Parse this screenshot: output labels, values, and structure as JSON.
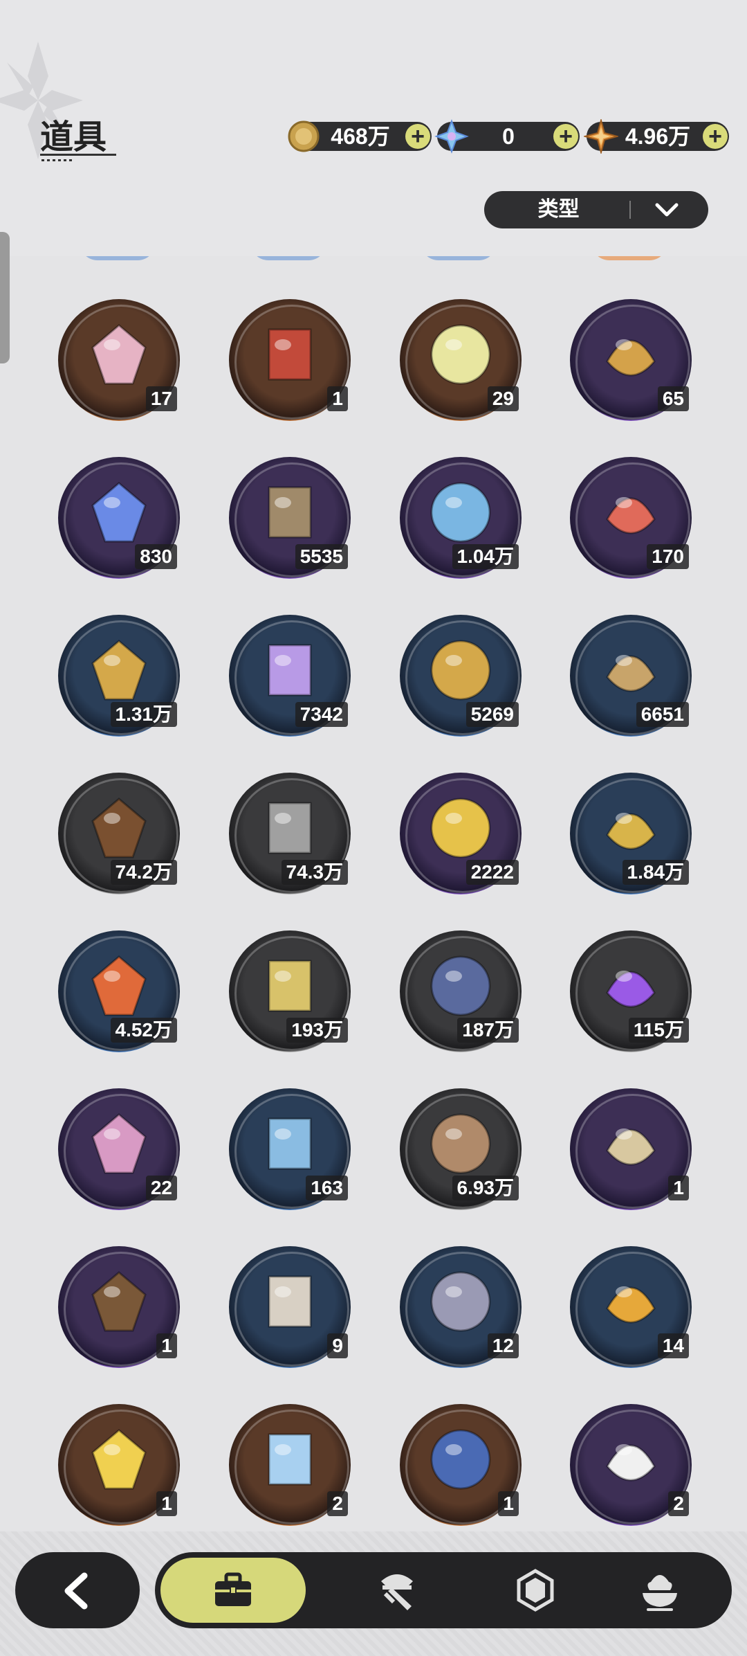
{
  "header": {
    "title": "道具",
    "currencies": [
      {
        "name": "coin-icon",
        "value": "468万"
      },
      {
        "name": "crystal-icon",
        "value": "0"
      },
      {
        "name": "star-gem-icon",
        "value": "4.96万"
      }
    ],
    "plus_label": "+",
    "filter": {
      "label": "类型"
    }
  },
  "colors": {
    "orange": "#e88a42",
    "purple": "#9a62e6",
    "blue": "#5a9aeb",
    "grey": "#c4c4c4",
    "accent": "#d6d87a",
    "dark": "#232325"
  },
  "items": [
    {
      "icon": "peach-fruit-icon",
      "rarity": "orange",
      "count": "17"
    },
    {
      "icon": "wheel-ticket-icon",
      "rarity": "orange",
      "count": "1"
    },
    {
      "icon": "rainbow-ticket-icon",
      "rarity": "orange",
      "count": "29"
    },
    {
      "icon": "meal-ticket-icon",
      "rarity": "purple",
      "count": "65"
    },
    {
      "icon": "moon-coin-icon",
      "rarity": "purple",
      "count": "830"
    },
    {
      "icon": "fist-coin-icon",
      "rarity": "purple",
      "count": "5535"
    },
    {
      "icon": "shield-coin-icon",
      "rarity": "purple",
      "count": "1.04万"
    },
    {
      "icon": "heart-coin-icon",
      "rarity": "purple",
      "count": "170"
    },
    {
      "icon": "golden-blade-icon",
      "rarity": "blue",
      "count": "1.31万"
    },
    {
      "icon": "scale-gem-icon",
      "rarity": "blue",
      "count": "7342"
    },
    {
      "icon": "gear-icon",
      "rarity": "blue",
      "count": "5269"
    },
    {
      "icon": "leaf-icon",
      "rarity": "blue",
      "count": "6651"
    },
    {
      "icon": "wood-logs-icon",
      "rarity": "grey",
      "count": "74.2万"
    },
    {
      "icon": "stone-bricks-icon",
      "rarity": "grey",
      "count": "74.3万"
    },
    {
      "icon": "gold-crystal-icon",
      "rarity": "purple",
      "count": "2222"
    },
    {
      "icon": "gold-dust-icon",
      "rarity": "blue",
      "count": "1.84万"
    },
    {
      "icon": "red-crystal-icon",
      "rarity": "blue",
      "count": "4.52万"
    },
    {
      "icon": "sand-pile-icon",
      "rarity": "grey",
      "count": "193万"
    },
    {
      "icon": "dark-crystal-icon",
      "rarity": "grey",
      "count": "187万"
    },
    {
      "icon": "purple-orb-icon",
      "rarity": "grey",
      "count": "115万"
    },
    {
      "icon": "pink-feed-bag-icon",
      "rarity": "purple",
      "count": "22"
    },
    {
      "icon": "blue-feed-bag-icon",
      "rarity": "blue",
      "count": "163"
    },
    {
      "icon": "brown-feed-bag-icon",
      "rarity": "grey",
      "count": "6.93万"
    },
    {
      "icon": "golden-egg-icon",
      "rarity": "purple",
      "count": "1"
    },
    {
      "icon": "brown-bundle-icon",
      "rarity": "purple",
      "count": "1"
    },
    {
      "icon": "plain-egg-icon",
      "rarity": "blue",
      "count": "9"
    },
    {
      "icon": "grey-bundle-icon",
      "rarity": "blue",
      "count": "12"
    },
    {
      "icon": "potion-vial-icon",
      "rarity": "blue",
      "count": "14"
    },
    {
      "icon": "golden-crown-icon",
      "rarity": "orange",
      "count": "1"
    },
    {
      "icon": "diamond-gift-icon",
      "rarity": "orange",
      "count": "2"
    },
    {
      "icon": "blue-book-icon",
      "rarity": "orange",
      "count": "1"
    },
    {
      "icon": "pillow-icon",
      "rarity": "purple",
      "count": "2"
    }
  ],
  "nav": {
    "back": "back-arrow-icon",
    "tabs": [
      {
        "icon": "briefcase-icon",
        "active": true
      },
      {
        "icon": "hat-sword-icon",
        "active": false
      },
      {
        "icon": "hexagon-gem-icon",
        "active": false
      },
      {
        "icon": "dessert-icon",
        "active": false
      }
    ]
  }
}
